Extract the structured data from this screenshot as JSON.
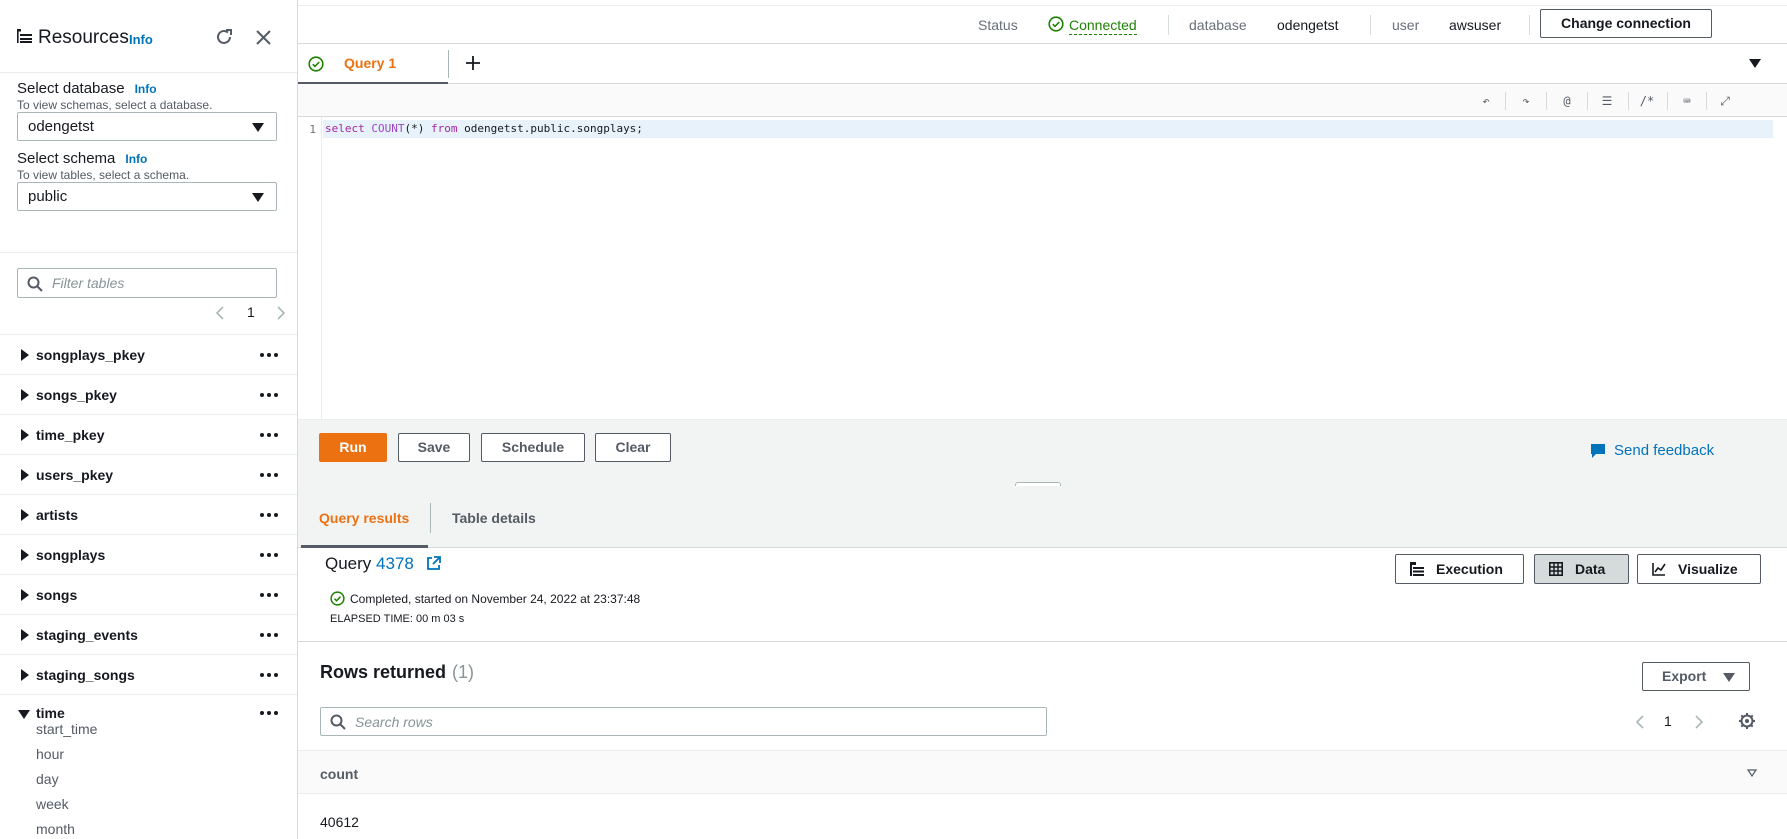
{
  "sidebar": {
    "title": "Resources",
    "title_info": "Info",
    "database": {
      "label": "Select database",
      "info": "Info",
      "hint": "To view schemas, select a database.",
      "value": "odengetst"
    },
    "schema": {
      "label": "Select schema",
      "info": "Info",
      "hint": "To view tables, select a schema.",
      "value": "public"
    },
    "filter_placeholder": "Filter tables",
    "page": "1",
    "tables": [
      {
        "name": "songplays_pkey"
      },
      {
        "name": "songs_pkey"
      },
      {
        "name": "time_pkey"
      },
      {
        "name": "users_pkey"
      },
      {
        "name": "artists"
      },
      {
        "name": "songplays"
      },
      {
        "name": "songs"
      },
      {
        "name": "staging_events"
      },
      {
        "name": "staging_songs"
      }
    ],
    "expanded_table": {
      "name": "time",
      "columns": [
        "start_time",
        "hour",
        "day",
        "week",
        "month"
      ]
    }
  },
  "header": {
    "status_label": "Status",
    "status_value": "Connected",
    "database_label": "database",
    "database_value": "odengetst",
    "user_label": "user",
    "user_value": "awsuser",
    "change_connection": "Change connection"
  },
  "tabs": [
    {
      "label": "Query 1"
    }
  ],
  "editor": {
    "line_number": "1",
    "tokens": [
      {
        "text": "select",
        "kind": "kw"
      },
      {
        "text": " ",
        "kind": "tx"
      },
      {
        "text": "COUNT",
        "kind": "fn"
      },
      {
        "text": "(*) ",
        "kind": "tx"
      },
      {
        "text": "from",
        "kind": "kw"
      },
      {
        "text": " odengetst.public.songplays;",
        "kind": "tx"
      }
    ]
  },
  "toolbar_icons": [
    "undo-icon",
    "redo-icon",
    "at-icon",
    "indent-icon",
    "comment-icon",
    "keyboard-icon",
    "fullscreen-icon"
  ],
  "actions": {
    "run": "Run",
    "save": "Save",
    "schedule": "Schedule",
    "clear": "Clear",
    "feedback": "Send feedback"
  },
  "results": {
    "tabs": {
      "query_results": "Query results",
      "table_details": "Table details"
    },
    "query_label": "Query",
    "query_id": "4378",
    "status": "Completed, started on November 24, 2022 at 23:37:48",
    "elapsed": "ELAPSED TIME: 00 m 03 s",
    "views": {
      "execution": "Execution",
      "data": "Data",
      "visualize": "Visualize"
    },
    "rows_title": "Rows returned",
    "rows_count": "(1)",
    "export": "Export",
    "search_placeholder": "Search rows",
    "page": "1",
    "column": "count",
    "cell": "40612"
  },
  "colors": {
    "accent": "#ec7211",
    "link": "#0073bb",
    "success": "#1d8102"
  }
}
